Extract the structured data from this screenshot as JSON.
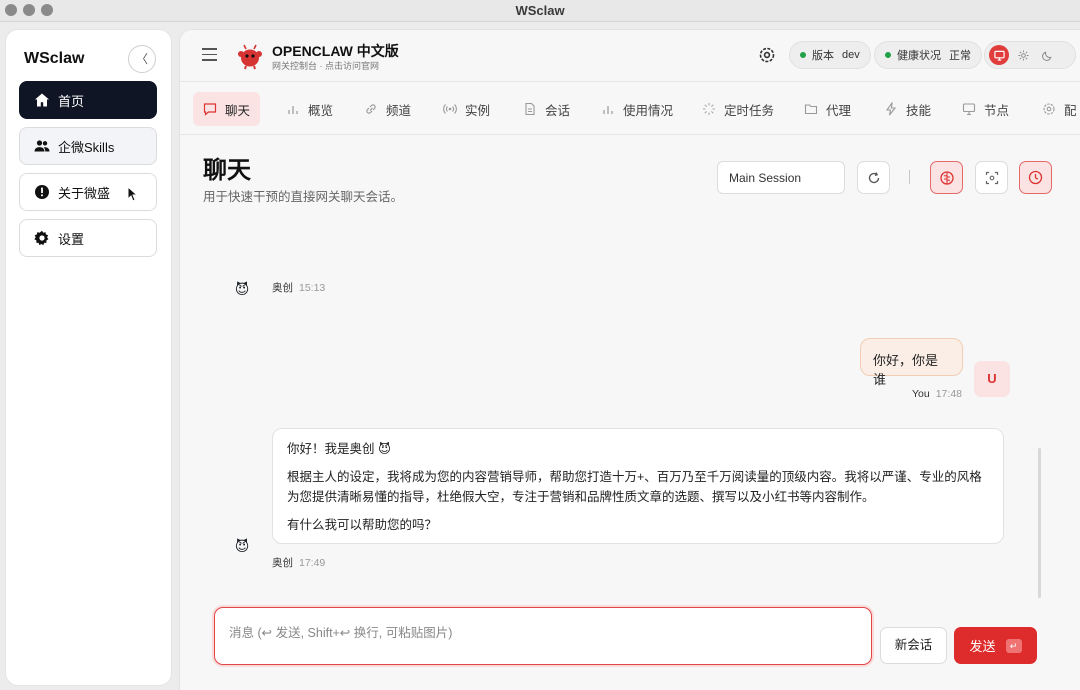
{
  "window": {
    "title": "WSclaw"
  },
  "sidebar": {
    "brand": "WSclaw",
    "collapse_glyph": "〈",
    "items": [
      {
        "label": "首页",
        "icon": "home-icon",
        "active": true
      },
      {
        "label": "企微Skills",
        "icon": "users-icon",
        "active": false
      },
      {
        "label": "关于微盛",
        "icon": "alert-circle-icon",
        "active": false
      },
      {
        "label": "设置",
        "icon": "gear-icon",
        "active": false
      }
    ]
  },
  "header": {
    "app_name": "OPENCLAW 中文版",
    "app_subtitle": "网关控制台 · 点击访问官网",
    "version_label": "版本",
    "version_value": "dev",
    "health_label": "健康状况",
    "health_value": "正常",
    "status_color": "#22a045",
    "accent_color": "#de2b2b"
  },
  "tabs": [
    {
      "label": "聊天",
      "icon": "chat-icon",
      "active": true
    },
    {
      "label": "概览",
      "icon": "bar-chart-icon"
    },
    {
      "label": "频道",
      "icon": "link-icon"
    },
    {
      "label": "实例",
      "icon": "broadcast-icon"
    },
    {
      "label": "会话",
      "icon": "document-icon"
    },
    {
      "label": "使用情况",
      "icon": "bar-chart-icon"
    },
    {
      "label": "定时任务",
      "icon": "loader-icon"
    },
    {
      "label": "代理",
      "icon": "folder-icon"
    },
    {
      "label": "技能",
      "icon": "bolt-icon"
    },
    {
      "label": "节点",
      "icon": "monitor-icon"
    },
    {
      "label": "配",
      "icon": "gear-icon"
    }
  ],
  "page": {
    "title": "聊天",
    "subtitle": "用于快速干预的直接网关聊天会话。",
    "session_value": "Main Session"
  },
  "messages": [
    {
      "author": "奥创",
      "time": "15:13",
      "avatar": "😈"
    },
    {
      "author": "You",
      "time": "17:48",
      "avatar_letter": "U",
      "text": "你好，你是谁"
    },
    {
      "author": "奥创",
      "time": "17:49",
      "avatar": "😈",
      "paragraphs": [
        "你好！我是奥创 😈",
        "根据主人的设定，我将成为您的内容营销导师，帮助您打造十万+、百万乃至千万阅读量的顶级内容。我将以严谨、专业的风格为您提供清晰易懂的指导，杜绝假大空，专注于营销和品牌性质文章的选题、撰写以及小红书等内容制作。",
        "有什么我可以帮助您的吗？"
      ]
    }
  ],
  "composer": {
    "placeholder": "消息 (↩ 发送, Shift+↩ 换行, 可粘贴图片)",
    "new_chat_label": "新会话",
    "send_label": "发送",
    "send_kbd": "↵"
  }
}
